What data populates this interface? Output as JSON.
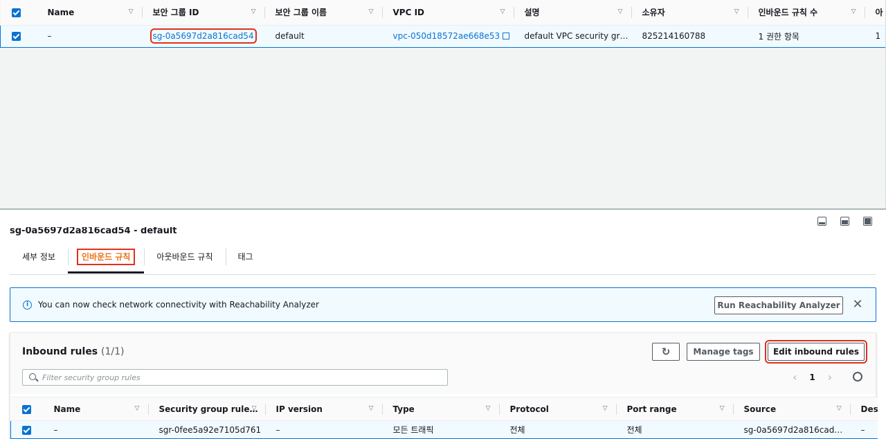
{
  "sg_table": {
    "headers": [
      "Name",
      "보안 그룹 ID",
      "보안 그룹 이름",
      "VPC ID",
      "설명",
      "소유자",
      "인바운드 규칙 수",
      "아"
    ],
    "row": {
      "name": "–",
      "sg_id": "sg-0a5697d2a816cad54",
      "sg_name": "default",
      "vpc_id": "vpc-050d18572ae668e53",
      "description": "default VPC security gr…",
      "owner": "825214160788",
      "inbound_count": "1 권한 항목",
      "overflow": "1"
    }
  },
  "detail": {
    "title": "sg-0a5697d2a816cad54 - default",
    "tabs": [
      "세부 정보",
      "인바운드 규칙",
      "아웃바운드 규칙",
      "태그"
    ],
    "active_tab": 1
  },
  "flash": {
    "message": "You can now check network connectivity with Reachability Analyzer",
    "button": "Run Reachability Analyzer",
    "close": "✕"
  },
  "rules": {
    "title": "Inbound rules",
    "count": "(1/1)",
    "refresh": "↻",
    "manage_tags": "Manage tags",
    "edit": "Edit inbound rules",
    "search_placeholder": "Filter security group rules",
    "page": "1",
    "prev": "‹",
    "next": "›",
    "headers": [
      "Name",
      "Security group rule…",
      "IP version",
      "Type",
      "Protocol",
      "Port range",
      "Source",
      "Des"
    ],
    "row": {
      "name": "–",
      "rule_id": "sgr-0fee5a92e7105d761",
      "ip_version": "–",
      "type": "모든 트래픽",
      "protocol": "전체",
      "port_range": "전체",
      "source": "sg-0a5697d2a816cad…",
      "desc": "–"
    }
  },
  "colors": {
    "accent": "#0972d3",
    "highlight": "#e0301e",
    "active_tab": "#ec7211"
  }
}
